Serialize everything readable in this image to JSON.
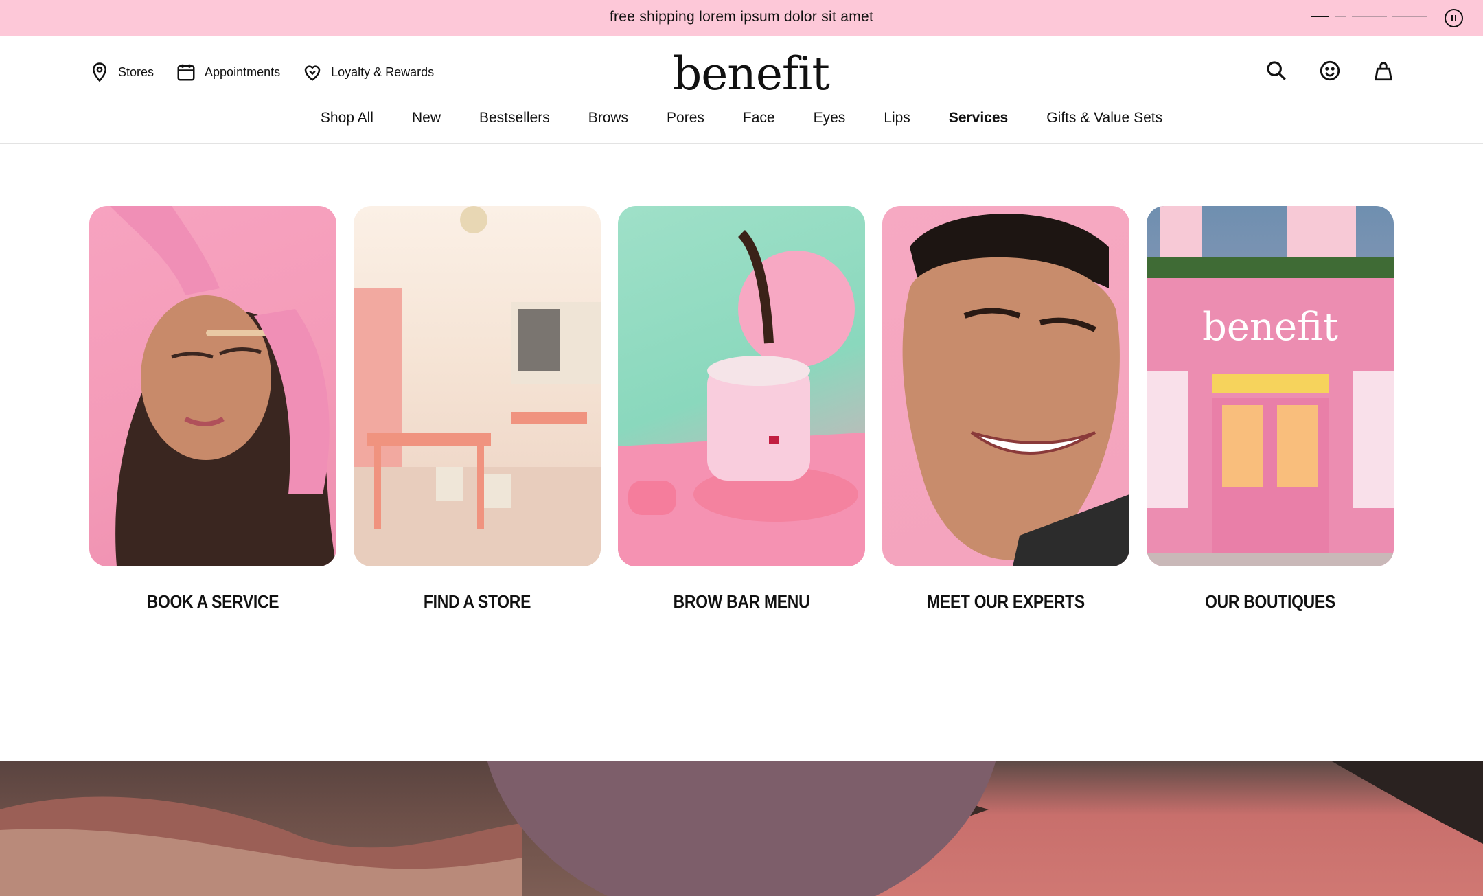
{
  "promo": {
    "message": "free shipping lorem ipsum dolor sit amet",
    "pause_icon": "pause-circle-icon"
  },
  "header": {
    "utility_links": [
      {
        "label": "Stores",
        "icon": "map-pin-icon"
      },
      {
        "label": "Appointments",
        "icon": "calendar-icon"
      },
      {
        "label": "Loyalty & Rewards",
        "icon": "heart-icon"
      }
    ],
    "logo_text": "benefit",
    "actions": [
      {
        "icon": "search-icon"
      },
      {
        "icon": "account-smiley-icon"
      },
      {
        "icon": "shopping-bag-icon"
      }
    ]
  },
  "nav": {
    "items": [
      {
        "label": "Shop All"
      },
      {
        "label": "New"
      },
      {
        "label": "Bestsellers"
      },
      {
        "label": "Brows"
      },
      {
        "label": "Pores"
      },
      {
        "label": "Face"
      },
      {
        "label": "Eyes"
      },
      {
        "label": "Lips"
      },
      {
        "label": "Services",
        "active": true
      },
      {
        "label": "Gifts & Value Sets"
      }
    ]
  },
  "cards": [
    {
      "label": "BOOK A SERVICE"
    },
    {
      "label": "FIND A STORE"
    },
    {
      "label": "BROW BAR MENU"
    },
    {
      "label": "MEET OUR EXPERTS"
    },
    {
      "label": "OUR BOUTIQUES"
    }
  ],
  "colors": {
    "promo_bg": "#fdc8d8",
    "text": "#111111",
    "divider": "#e3e3e3"
  }
}
